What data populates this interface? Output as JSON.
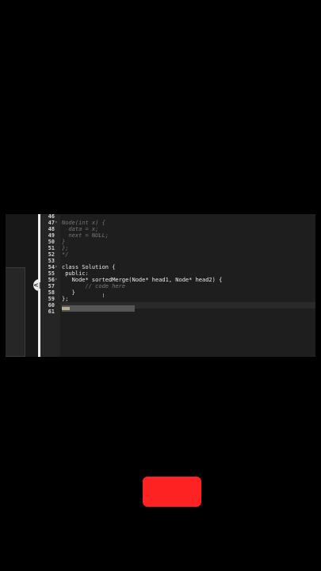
{
  "editor": {
    "resize_handle_icon": "<|>",
    "lines": [
      {
        "num": "46",
        "text": "",
        "comment": false,
        "fold": ""
      },
      {
        "num": "47",
        "text": "Node(int x) {",
        "comment": true,
        "fold": "▾"
      },
      {
        "num": "48",
        "text": "  data = x;",
        "comment": true,
        "fold": ""
      },
      {
        "num": "49",
        "text": "  next = NULL;",
        "comment": true,
        "fold": ""
      },
      {
        "num": "50",
        "text": "}",
        "comment": true,
        "fold": ""
      },
      {
        "num": "51",
        "text": "};",
        "comment": true,
        "fold": ""
      },
      {
        "num": "52",
        "text": "*/",
        "comment": true,
        "fold": ""
      },
      {
        "num": "53",
        "text": "",
        "comment": false,
        "fold": ""
      },
      {
        "num": "54",
        "text": "class Solution {",
        "comment": false,
        "fold": "▾"
      },
      {
        "num": "55",
        "text": " public:",
        "comment": false,
        "fold": ""
      },
      {
        "num": "56",
        "text": "   Node* sortedMerge(Node* head1, Node* head2) {",
        "comment": false,
        "fold": "▾"
      },
      {
        "num": "57",
        "text": "       // code here",
        "comment": true,
        "fold": ""
      },
      {
        "num": "58",
        "text": "   }",
        "comment": false,
        "fold": ""
      },
      {
        "num": "59",
        "text": "};",
        "comment": false,
        "fold": ""
      },
      {
        "num": "60",
        "text": "",
        "comment": false,
        "fold": ""
      },
      {
        "num": "61",
        "text": "",
        "comment": false,
        "fold": ""
      }
    ]
  },
  "colors": {
    "background": "#000000",
    "editor_bg": "#1e1e1e",
    "record_button": "#ff2222"
  }
}
